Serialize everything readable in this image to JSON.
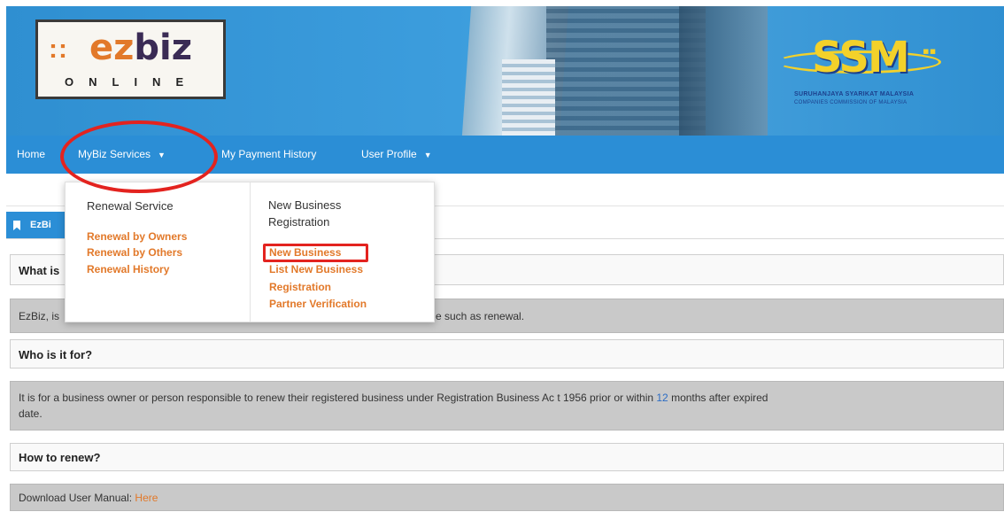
{
  "header": {
    "logo": {
      "mark": "::",
      "word_a": "ez",
      "word_b": "biz",
      "subtitle": "ONLINE"
    },
    "ssm": {
      "mark": "SSM",
      "name_line1": "SURUHANJAYA SYARIKAT MALAYSIA",
      "name_line2": "COMPANIES COMMISSION OF MALAYSIA"
    }
  },
  "nav": {
    "items": [
      "Home",
      "MyBiz Services",
      "My Payment History",
      "User Profile"
    ]
  },
  "dropdown": {
    "col1": {
      "heading": "Renewal Service",
      "links": [
        "Renewal by Owners",
        "Renewal by Others",
        "Renewal History"
      ]
    },
    "col2": {
      "heading_line1": "New Business",
      "heading_line2": "Registration",
      "links": [
        "New Business",
        "List New Business",
        "Registration",
        "Partner Verification"
      ]
    }
  },
  "section": {
    "tab_label": "EzBi"
  },
  "faq": {
    "q1": "What is",
    "a1_start": "EzBiz, is",
    "a1_end": "e such as renewal.",
    "q2": "Who is it for?",
    "a2_part1": "It is for a business owner or person responsible to renew their registered business under Registration Business Ac t 1956 prior or within ",
    "a2_num": "12",
    "a2_part2": " months after expired",
    "a2_line2": "date.",
    "q3": "How to renew?",
    "a3_prefix": "Download User Manual: ",
    "a3_link": "Here"
  },
  "colors": {
    "nav_blue": "#2b8ed6",
    "link_orange": "#e2792a",
    "annotation_red": "#e3231f"
  }
}
